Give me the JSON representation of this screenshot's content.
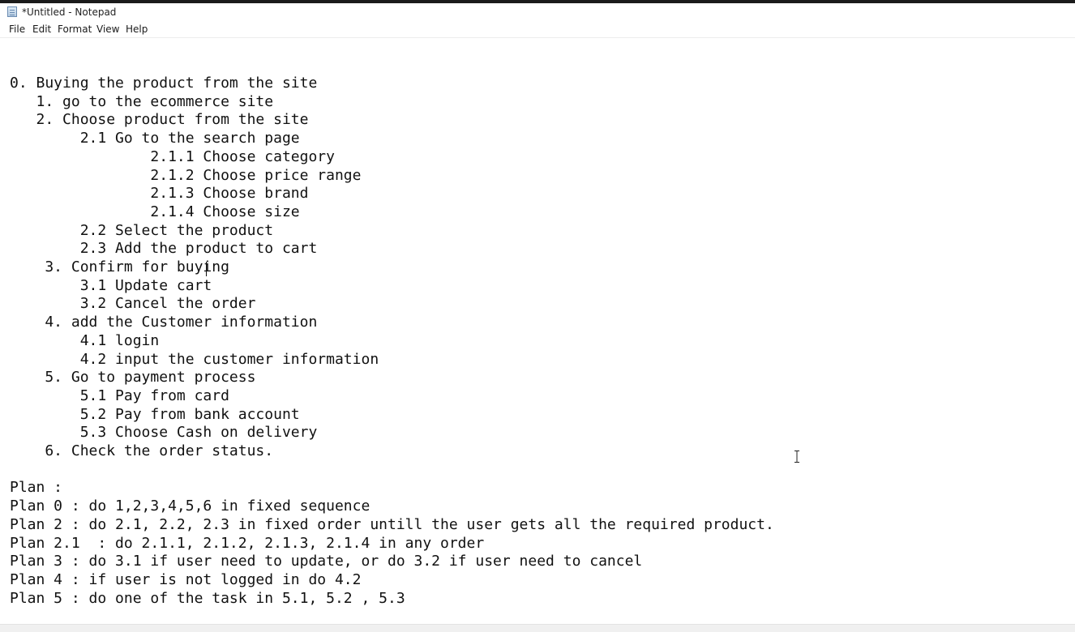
{
  "window": {
    "title": "*Untitled - Notepad",
    "icon": "notepad-icon"
  },
  "menubar": {
    "file": "File",
    "edit": "Edit",
    "format": "Format",
    "view": "View",
    "help": "Help"
  },
  "editor": {
    "content": "0. Buying the product from the site\n   1. go to the ecommerce site\n   2. Choose product from the site\n        2.1 Go to the search page\n                2.1.1 Choose category\n                2.1.2 Choose price range\n                2.1.3 Choose brand\n                2.1.4 Choose size\n        2.2 Select the product\n        2.3 Add the product to cart\n    3. Confirm for buying\n        3.1 Update cart\n        3.2 Cancel the order\n    4. add the Customer information\n        4.1 login\n        4.2 input the customer information\n    5. Go to payment process\n        5.1 Pay from card\n        5.2 Pay from bank account\n        5.3 Choose Cash on delivery\n    6. Check the order status.\n\nPlan :\nPlan 0 : do 1,2,3,4,5,6 in fixed sequence\nPlan 2 : do 2.1, 2.2, 2.3 in fixed order untill the user gets all the required product.\nPlan 2.1  : do 2.1.1, 2.1.2, 2.1.3, 2.1.4 in any order\nPlan 3 : do 3.1 if user need to update, or do 3.2 if user need to cancel\nPlan 4 : if user is not logged in do 4.2\nPlan 5 : do one of the task in 5.1, 5.2 , 5.3"
  }
}
